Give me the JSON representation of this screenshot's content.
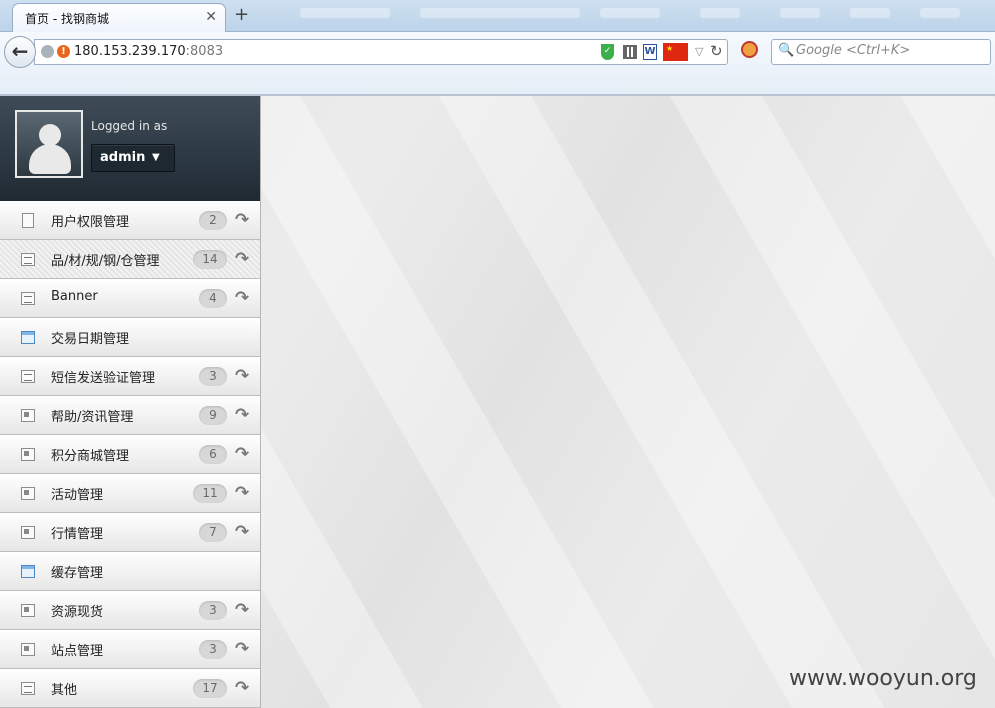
{
  "browser": {
    "tab_title": "首页 - 找钢商城",
    "tab_close": "✕",
    "new_tab": "+",
    "back": "←",
    "url_host": "180.153.239.170",
    "url_port": ":8083",
    "search_placeholder": "Google <Ctrl+K>"
  },
  "profile": {
    "logged_in_label": "Logged in as",
    "username": "admin"
  },
  "menu": [
    {
      "label": "用户权限管理",
      "badge": "2",
      "icon": "document-icon"
    },
    {
      "label": "品/材/规/钢/仓管理",
      "badge": "14",
      "icon": "list-icon",
      "active": true
    },
    {
      "label": "Banner",
      "badge": "4",
      "icon": "list-icon"
    },
    {
      "label": "交易日期管理",
      "badge": "",
      "icon": "calendar-icon"
    },
    {
      "label": "短信发送验证管理",
      "badge": "3",
      "icon": "list-icon"
    },
    {
      "label": "帮助/资讯管理",
      "badge": "9",
      "icon": "news-icon"
    },
    {
      "label": "积分商城管理",
      "badge": "6",
      "icon": "news-icon"
    },
    {
      "label": "活动管理",
      "badge": "11",
      "icon": "news-icon"
    },
    {
      "label": "行情管理",
      "badge": "7",
      "icon": "news-icon"
    },
    {
      "label": "缓存管理",
      "badge": "",
      "icon": "calendar-icon"
    },
    {
      "label": "资源现货",
      "badge": "3",
      "icon": "news-icon"
    },
    {
      "label": "站点管理",
      "badge": "3",
      "icon": "news-icon"
    },
    {
      "label": "其他",
      "badge": "17",
      "icon": "list-icon"
    }
  ],
  "watermark": "www.wooyun.org"
}
